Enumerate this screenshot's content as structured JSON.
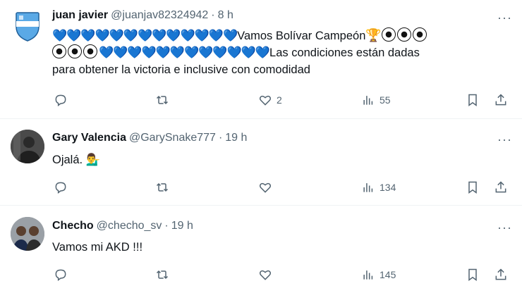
{
  "posts": [
    {
      "name": "juan javier",
      "handle": "@juanjav82324942",
      "dot": "·",
      "time": "8 h",
      "text_line1_suffix": "Vamos Bolívar Campeón",
      "text_line2_suffix": "Las condiciones están dadas",
      "text_line3": "para obtener la victoria e inclusive con comodidad",
      "hearts1": "💙💙💙💙💙💙💙💙💙💙💙💙💙",
      "hearts2": "💙💙💙💙💙💙💙💙💙💙💙💙",
      "trophy": "🏆",
      "replies": "",
      "reposts": "",
      "likes": "2",
      "views": "55"
    },
    {
      "name": "Gary Valencia",
      "handle": "@GarySnake777",
      "dot": "·",
      "time": "19 h",
      "text": "Ojalá. 💁‍♂️",
      "replies": "",
      "reposts": "",
      "likes": "",
      "views": "134"
    },
    {
      "name": "Checho",
      "handle": "@checho_sv",
      "dot": "·",
      "time": "19 h",
      "text": "Vamos mi AKD !!!",
      "replies": "",
      "reposts": "",
      "likes": "",
      "views": "145"
    }
  ],
  "more_label": "···",
  "colors": {
    "accent_heart": "#5dade2",
    "muted": "#536471",
    "divider": "#eff3f4"
  },
  "icons": [
    "reply-icon",
    "repost-icon",
    "like-icon",
    "views-icon",
    "bookmark-icon",
    "share-icon",
    "more-icon"
  ]
}
